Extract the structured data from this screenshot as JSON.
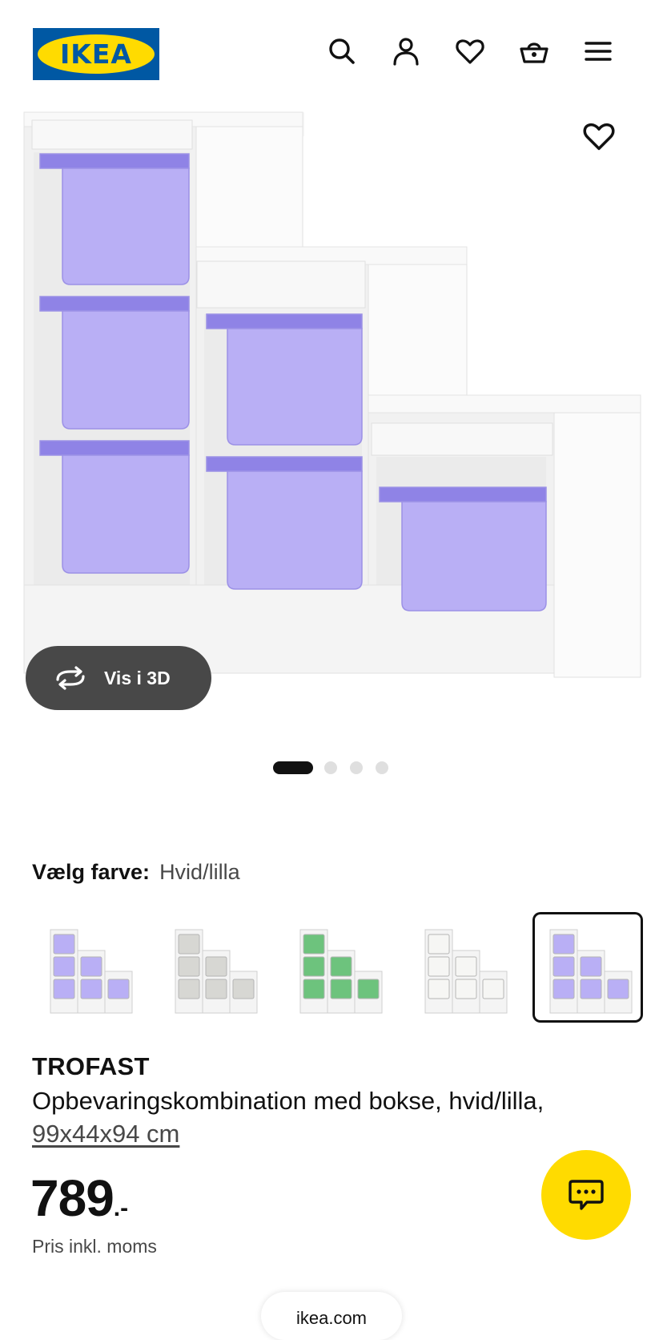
{
  "header": {
    "logo_text": "IKEA",
    "logo_reg": "®",
    "icons": [
      "search-icon",
      "account-icon",
      "heart-icon",
      "basket-icon",
      "menu-icon"
    ]
  },
  "gallery": {
    "view_3d_label": "Vis i 3D",
    "dots": 4,
    "active_dot": 1
  },
  "color_chooser": {
    "label": "Vælg farve:",
    "value": "Hvid/lilla",
    "options": [
      {
        "name": "white-lilac",
        "box_color": "#b9aff5"
      },
      {
        "name": "white-grey",
        "box_color": "#d7d7d3"
      },
      {
        "name": "white-green",
        "box_color": "#6dc37d"
      },
      {
        "name": "white-white",
        "box_color": "#f6f6f4"
      },
      {
        "name": "white-lilac",
        "box_color": "#b9aff5"
      }
    ],
    "selected_index": 4
  },
  "product": {
    "name": "TROFAST",
    "description": "Opbevaringskombination med bokse, hvid/lilla,",
    "size": "99x44x94 cm",
    "price": "789",
    "price_suffix": ".-",
    "vat_note": "Pris inkl. moms"
  },
  "browser": {
    "url": "ikea.com"
  },
  "colors": {
    "ikea_blue": "#0058a3",
    "ikea_yellow": "#ffdb00",
    "lilac": "#b9aff5",
    "button_dark": "#484848"
  }
}
